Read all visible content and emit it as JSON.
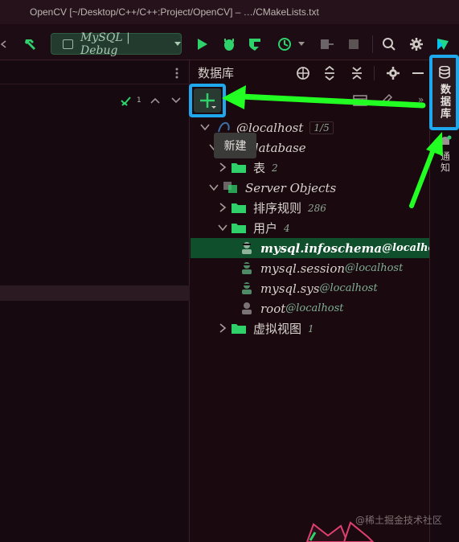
{
  "window": {
    "title": "OpenCV [~/Desktop/C++/C++:Project/OpenCV] – …/CMakeLists.txt"
  },
  "toolbar": {
    "run_config": "MySQL | Debug"
  },
  "left_panel": {
    "inspection_count": "1"
  },
  "database_panel": {
    "title": "数据库",
    "new_tooltip": "新建",
    "tree": {
      "connection": {
        "label": "@localhost",
        "count": "1/5"
      },
      "database": {
        "label": "database"
      },
      "tables": {
        "label": "表",
        "count": "2"
      },
      "server_objects": {
        "label": "Server Objects"
      },
      "collations": {
        "label": "排序规则",
        "count": "286"
      },
      "users": {
        "label": "用户",
        "count": "4"
      },
      "user_items": [
        {
          "name": "mysql.infoschema",
          "host": "@localhost"
        },
        {
          "name": "mysql.session",
          "host": "@localhost"
        },
        {
          "name": "mysql.sys",
          "host": "@localhost"
        },
        {
          "name": "root",
          "host": "@localhost"
        }
      ],
      "virtual_views": {
        "label": "虚拟视图",
        "count": "1"
      }
    }
  },
  "right_strip": {
    "database_tab": "数据库",
    "notifications_tab": "通知"
  },
  "watermark": "@稀土掘金技术社区",
  "colors": {
    "accent_green": "#2ecc71",
    "highlight_blue": "#1ea8ee",
    "arrow_green": "#22ff22",
    "selection": "#0f4f2c"
  }
}
